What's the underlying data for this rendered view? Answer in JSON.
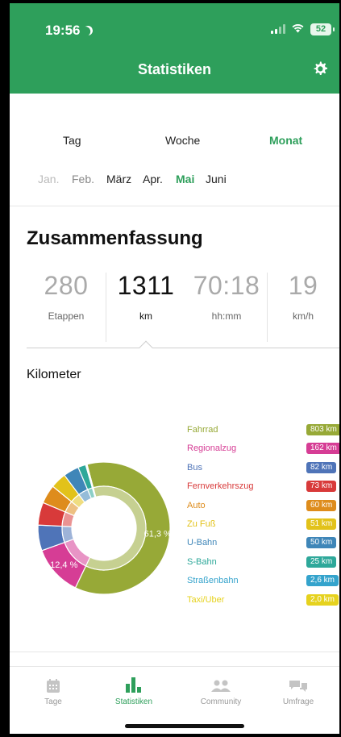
{
  "status_bar": {
    "time": "19:56",
    "battery": "52"
  },
  "header": {
    "title": "Statistiken"
  },
  "period_tabs": [
    {
      "label": "Tag",
      "active": false
    },
    {
      "label": "Woche",
      "active": false
    },
    {
      "label": "Monat",
      "active": true
    }
  ],
  "months": [
    {
      "label": "Jan.",
      "state": "faded"
    },
    {
      "label": "Feb.",
      "state": "dim"
    },
    {
      "label": "März",
      "state": "normal"
    },
    {
      "label": "Apr.",
      "state": "normal"
    },
    {
      "label": "Mai",
      "state": "active"
    },
    {
      "label": "Juni",
      "state": "normal"
    }
  ],
  "summary": {
    "title": "Zusammenfassung",
    "stats": [
      {
        "value": "280",
        "label": "Etappen",
        "selected": false
      },
      {
        "value": "1311",
        "label": "km",
        "selected": true
      },
      {
        "value": "70:18",
        "label": "hh:mm",
        "selected": false
      },
      {
        "value": "19",
        "label": "km/h",
        "selected": false
      }
    ]
  },
  "chart": {
    "title": "Kilometer",
    "donut_labels": {
      "fahrrad": "61,3 %",
      "regionalzug": "12,4 %"
    }
  },
  "chart_data": {
    "type": "pie",
    "title": "Kilometer",
    "categories": [
      "Fahrrad",
      "Regionalzug",
      "Bus",
      "Fernverkehrszug",
      "Auto",
      "Zu Fuß",
      "U-Bahn",
      "S-Bahn",
      "Straßenbahn",
      "Taxi/Uber"
    ],
    "values": [
      803,
      162,
      82,
      73,
      60,
      51,
      50,
      25,
      2.6,
      2.0
    ],
    "value_labels": [
      "803 km",
      "162 km",
      "82 km",
      "73 km",
      "60 km",
      "51 km",
      "50 km",
      "25 km",
      "2,6 km",
      "2,0 km"
    ],
    "colors": [
      "#97a937",
      "#d63d95",
      "#4f74b8",
      "#d83a3a",
      "#de8c1c",
      "#e2c21a",
      "#3f86b8",
      "#2ea89a",
      "#34a3cc",
      "#e6d21e"
    ],
    "percent_labels": {
      "Fahrrad": "61,3 %",
      "Regionalzug": "12,4 %"
    },
    "legend_position": "right"
  },
  "tabbar": [
    {
      "label": "Tage",
      "icon": "calendar-icon",
      "active": false
    },
    {
      "label": "Statistiken",
      "icon": "bar-chart-icon",
      "active": true
    },
    {
      "label": "Community",
      "icon": "community-icon",
      "active": false
    },
    {
      "label": "Umfrage",
      "icon": "chat-bubbles-icon",
      "active": false
    }
  ],
  "colors": {
    "accent": "#2e9f5b"
  }
}
